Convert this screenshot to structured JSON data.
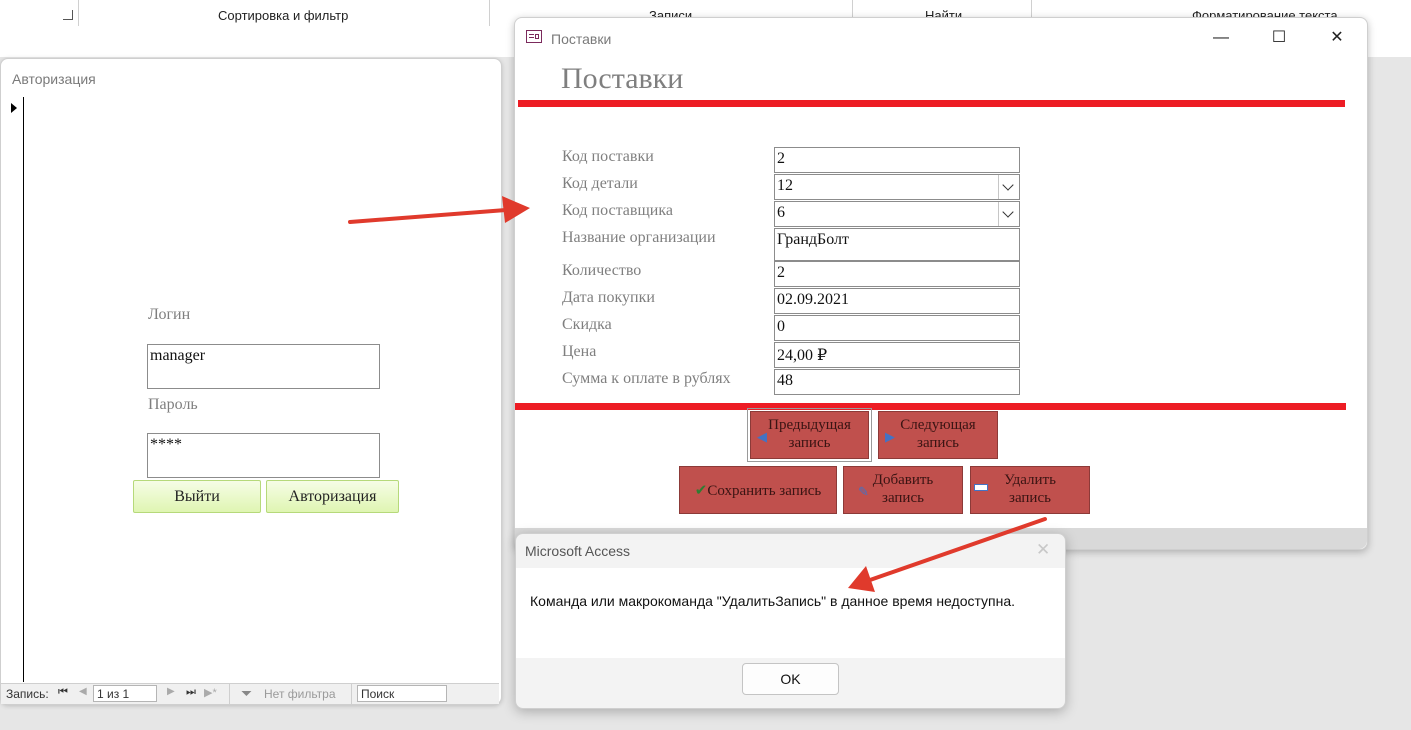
{
  "ribbon": {
    "groups": [
      "Сортировка и фильтр",
      "Записи",
      "Найти",
      "Форматирование текста"
    ]
  },
  "auth_window": {
    "title": "Авторизация",
    "login_label": "Логин",
    "login_value": "manager",
    "password_label": "Пароль",
    "password_value": "****",
    "exit_button": "Выйти",
    "auth_button": "Авторизация",
    "navigation": {
      "record_label": "Запись:",
      "position": "1 из 1",
      "filter": "Нет фильтра",
      "search": "Поиск"
    }
  },
  "supplies_form": {
    "window_title": "Поставки",
    "heading": "Поставки",
    "fields": [
      {
        "label": "Код поставки",
        "value": "2",
        "combo": false
      },
      {
        "label": "Код детали",
        "value": "12",
        "combo": true
      },
      {
        "label": "Код поставщика",
        "value": "6",
        "combo": true
      },
      {
        "label": "Название организации",
        "value": "ГрандБолт",
        "combo": false
      },
      {
        "label": "Количество",
        "value": "2",
        "combo": false
      },
      {
        "label": "Дата покупки",
        "value": "02.09.2021",
        "combo": false
      },
      {
        "label": "Скидка",
        "value": "0",
        "combo": false
      },
      {
        "label": "Цена",
        "value": "24,00 ₽",
        "combo": false
      },
      {
        "label": "Сумма к оплате в рублях",
        "value": "48",
        "combo": false
      }
    ],
    "buttons": {
      "prev_line1": "Предыдущая",
      "prev_line2": "запись",
      "next_line1": "Следующая",
      "next_line2": "запись",
      "save": "Сохранить запись",
      "add_line1": "Добавить",
      "add_line2": "запись",
      "delete_line1": "Удалить",
      "delete_line2": "запись"
    }
  },
  "dialog": {
    "title": "Microsoft Access",
    "message": "Команда или макрокоманда \"УдалитьЗапись\" в данное время недоступна.",
    "ok": "OK"
  },
  "colors": {
    "accent_red": "#ed1c24",
    "button_red": "#c0504d",
    "button_green": "#dff5b2",
    "annotation_arrow": "#e03a2c"
  }
}
